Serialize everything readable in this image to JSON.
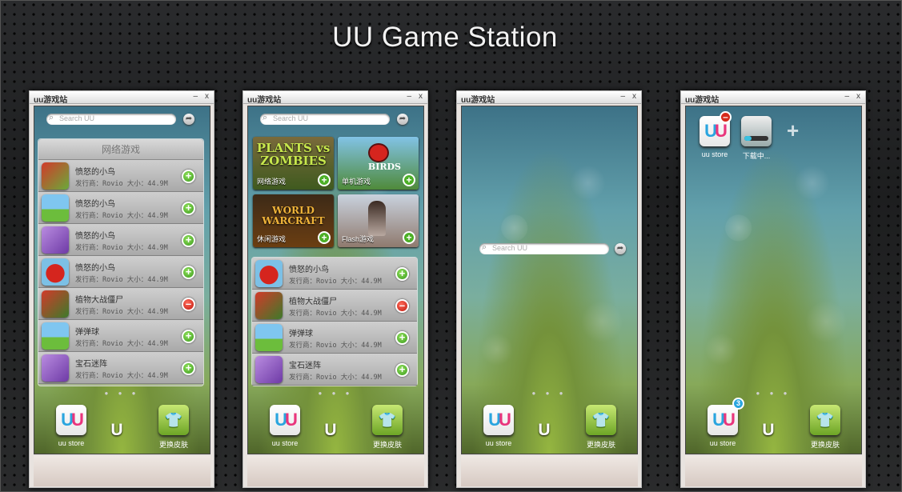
{
  "title": "UU Game Station",
  "window_title": "uu游戏站",
  "window_controls": {
    "minimize": "–",
    "close": "x"
  },
  "search_placeholder": "Search UU",
  "category_header": "网络游戏",
  "publisher_line": "发行商：Rovio 大小：44.9M",
  "panel1_items": [
    {
      "name": "愤怒的小鸟",
      "icon": "bird-zombie-icon",
      "action": "add"
    },
    {
      "name": "愤怒的小鸟",
      "icon": "pet-icon",
      "action": "add"
    },
    {
      "name": "愤怒的小鸟",
      "icon": "jewel-icon",
      "action": "add"
    },
    {
      "name": "愤怒的小鸟",
      "icon": "angry-bird-icon",
      "action": "add"
    },
    {
      "name": "植物大战僵尸",
      "icon": "zombie-icon",
      "action": "remove"
    },
    {
      "name": "弹弹球",
      "icon": "pet-icon",
      "action": "add"
    },
    {
      "name": "宝石迷阵",
      "icon": "jewel-icon",
      "action": "add"
    }
  ],
  "panel2_items": [
    {
      "name": "愤怒的小鸟",
      "icon": "angry-bird-icon",
      "action": "add"
    },
    {
      "name": "植物大战僵尸",
      "icon": "zombie-icon",
      "action": "remove"
    },
    {
      "name": "弹弹球",
      "icon": "pet-icon",
      "action": "add"
    },
    {
      "name": "宝石迷阵",
      "icon": "jewel-icon",
      "action": "add"
    }
  ],
  "tiles": [
    {
      "label": "网络游戏",
      "art": "PLANTS vs ZOMBIES"
    },
    {
      "label": "单机游戏",
      "art": "BIRDS"
    },
    {
      "label": "休闲游戏",
      "art": "WORLD WARCRAFT"
    },
    {
      "label": "Flash游戏",
      "art": ""
    }
  ],
  "dock": {
    "store_label": "uu store",
    "skin_label": "更换皮肤",
    "mid_glyph": "U"
  },
  "page_dots": "● ● ●",
  "win4": {
    "store_label": "uu store",
    "downloading_label": "下载中...",
    "add_glyph": "+",
    "badge_count": "3",
    "remove_glyph": "–"
  },
  "colors": {
    "add": "#4caf26",
    "remove": "#d62a1a",
    "uu_blue": "#2aa5df",
    "uu_pink": "#e9357c"
  }
}
